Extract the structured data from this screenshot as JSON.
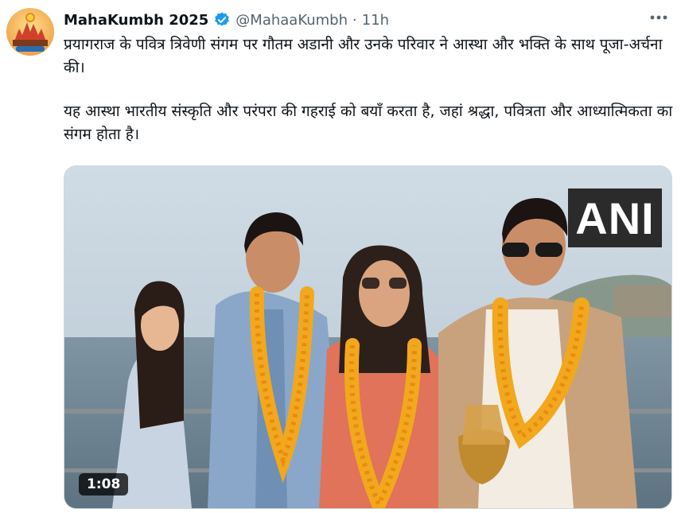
{
  "post": {
    "display_name": "MahaKumbh 2025",
    "handle": "@MahaaKumbh",
    "separator": "·",
    "time": "11h",
    "paragraph_1": "प्रयागराज के पवित्र त्रिवेणी संगम पर गौतम अडानी और उनके परिवार ने आस्था और भक्ति के साथ पूजा-अर्चना की।",
    "paragraph_2": "यह आस्था भारतीय संस्कृति और परंपरा की गहराई को बयाँ करता है, जहां श्रद्धा, पवित्रता और आध्यात्मिकता का संगम होता है।"
  },
  "media": {
    "watermark": "ANI",
    "duration": "1:08"
  },
  "icons": {
    "verified": "verified-badge-icon",
    "more": "more-options-icon"
  },
  "colors": {
    "verified_blue": "#1d9bf0",
    "secondary_text": "#536471",
    "primary_text": "#0f1419"
  }
}
